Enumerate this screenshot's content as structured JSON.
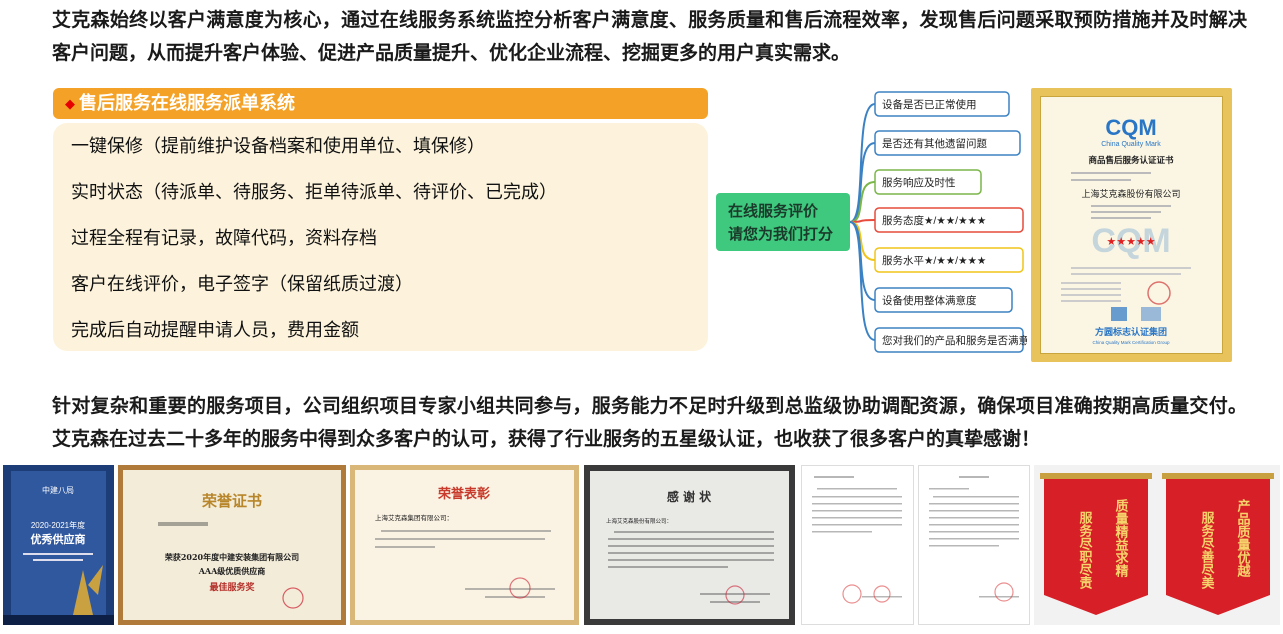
{
  "intro_text": "艾克森始终以客户满意度为核心，通过在线服务系统监控分析客户满意度、服务质量和售后流程效率，发现售后问题采取预防措施并及时解决客户问题，从而提升客户体验、促进产品质量提升、优化企业流程、挖掘更多的用户真实需求。",
  "panel": {
    "title": "售后服务在线服务派单系统",
    "items": [
      "一键保修（提前维护设备档案和使用单位、填保修）",
      "实时状态（待派单、待服务、拒单待派单、待评价、已完成）",
      "过程全程有记录，故障代码，资料存档",
      "客户在线评价，电子签字（保留纸质过渡）",
      "完成后自动提醒申请人员，费用金额"
    ]
  },
  "mindmap": {
    "center_lines": [
      "在线服务评价",
      "请您为我们打分"
    ],
    "branches": [
      "设备是否已正常使用",
      "是否还有其他遗留问题",
      "服务响应及时性",
      "服务态度★/★★/★★★",
      "服务水平★/★★/★★★",
      "设备使用整体满意度",
      "您对我们的产品和服务是否满意"
    ],
    "branch_colors": [
      "#3b82c4",
      "#3b82c4",
      "#7ab648",
      "#e64b3c",
      "#f0c419",
      "#3b82c4",
      "#3b82c4"
    ]
  },
  "certificate": {
    "logo": "CQM",
    "logo_sub": "China Quality Mark",
    "title": "商品售后服务认证证书",
    "company": "上海艾克森股份有限公司",
    "issuer": "方圆标志认证集团",
    "issuer_sub": "China Quality Mark Certification Group"
  },
  "outro_text": "针对复杂和重要的服务项目，公司组织项目专家小组共同参与，服务能力不足时升级到总监级协助调配资源，确保项目准确按期高质量交付。艾克森在过去二十多年的服务中得到众多客户的认可，获得了行业服务的五星级认证，也收获了很多客户的真挚感谢！",
  "awards": {
    "trophy": {
      "top": "中建八局",
      "year": "2020-2021年度",
      "name": "优秀供应商"
    },
    "honor": {
      "title": "荣誉证书",
      "line1": "荣获2020年度中建安装集团有限公司",
      "line2": "AAA级优质供应商",
      "line3": "最佳服务奖"
    },
    "commend": {
      "title": "荣誉表彰",
      "company": "上海艾克森集团有限公司："
    },
    "thanks": {
      "title": "感 谢 状",
      "company": "上海艾克森股份有限公司："
    },
    "banner1": {
      "main": "服务尽职尽责",
      "side": "质量精益求精"
    },
    "banner2": {
      "main": "服务尽善尽美",
      "side": "产品质量优越"
    }
  }
}
